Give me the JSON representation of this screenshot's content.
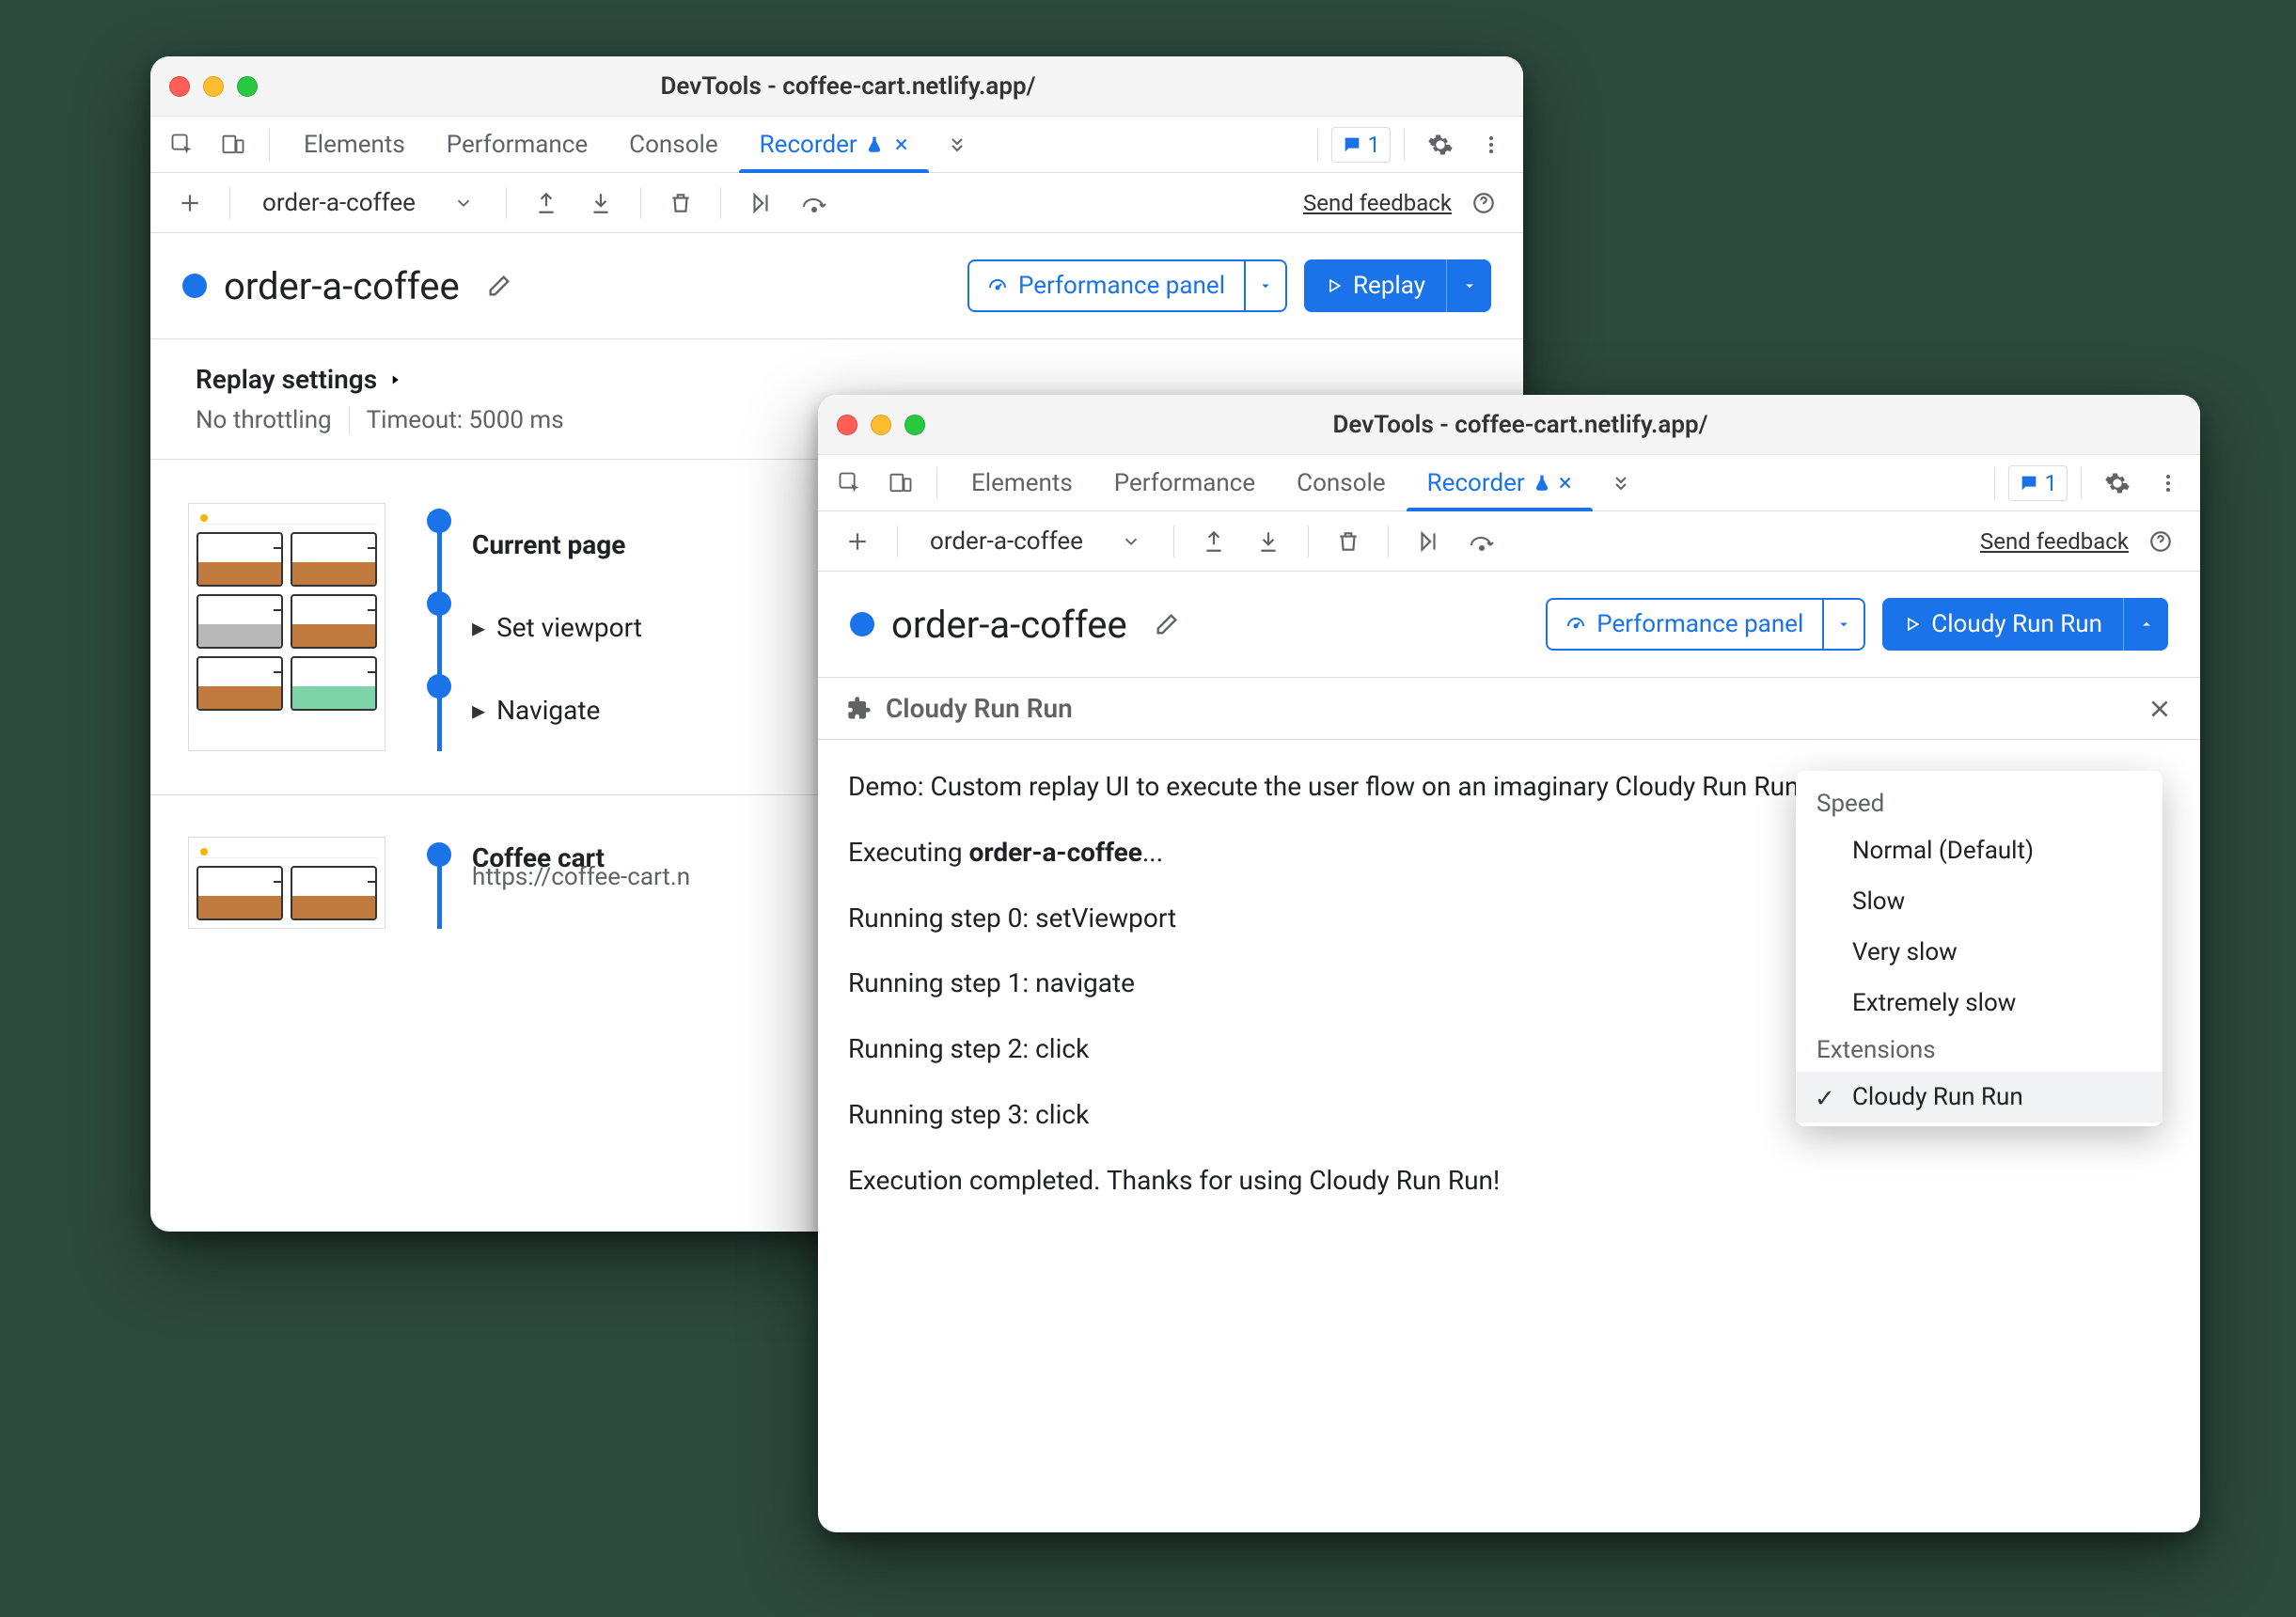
{
  "windows": {
    "back": {
      "title": "DevTools - coffee-cart.netlify.app/",
      "tabs": [
        "Elements",
        "Performance",
        "Console",
        "Recorder"
      ],
      "active_tab": "Recorder",
      "issues_count": "1",
      "toolbar": {
        "recording": "order-a-coffee",
        "feedback": "Send feedback"
      },
      "recording_name": "order-a-coffee",
      "perf_panel": "Performance panel",
      "replay_label": "Replay",
      "replay_settings_title": "Replay settings",
      "throttle": "No throttling",
      "timeout": "Timeout: 5000 ms",
      "steps": [
        {
          "label": "Current page",
          "bold": true
        },
        {
          "label": "Set viewport"
        },
        {
          "label": "Navigate"
        }
      ],
      "next_section": {
        "title": "Coffee cart",
        "url": "https://coffee-cart.n"
      }
    },
    "front": {
      "title": "DevTools - coffee-cart.netlify.app/",
      "tabs": [
        "Elements",
        "Performance",
        "Console",
        "Recorder"
      ],
      "active_tab": "Recorder",
      "issues_count": "1",
      "toolbar": {
        "recording": "order-a-coffee",
        "feedback": "Send feedback"
      },
      "recording_name": "order-a-coffee",
      "perf_panel": "Performance panel",
      "run_label": "Cloudy Run Run",
      "ext_name": "Cloudy Run Run",
      "log": {
        "desc": "Demo: Custom replay UI to execute the user flow on an imaginary Cloudy Run Run platform.",
        "exec_prefix": "Executing ",
        "exec_name": "order-a-coffee",
        "exec_suffix": "...",
        "lines": [
          "Running step 0: setViewport",
          "Running step 1: navigate",
          "Running step 2: click",
          "Running step 3: click"
        ],
        "done": "Execution completed. Thanks for using Cloudy Run Run!"
      },
      "dropdown": {
        "group1": "Speed",
        "items1": [
          "Normal (Default)",
          "Slow",
          "Very slow",
          "Extremely slow"
        ],
        "group2": "Extensions",
        "items2": [
          "Cloudy Run Run"
        ],
        "selected": "Cloudy Run Run"
      }
    }
  }
}
